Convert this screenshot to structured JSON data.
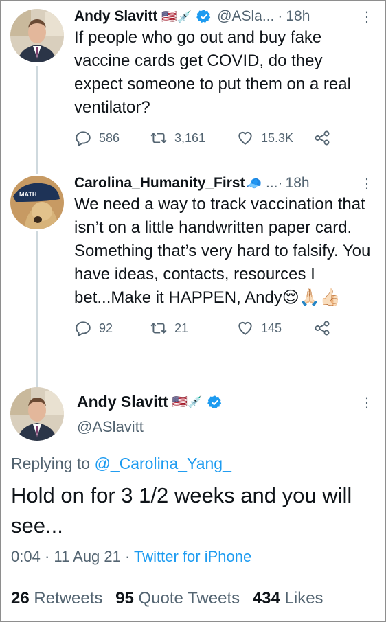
{
  "tweet1": {
    "name": "Andy Slavitt",
    "badges": "🇺🇸💉",
    "handle": "@ASla...",
    "dot": "·",
    "time": "18h",
    "more": "⋮",
    "text": "If people who go out and buy fake vaccine cards get COVID, do they expect someone to put them on a real ventilator?",
    "replies": "586",
    "retweets": "3,161",
    "likes": "15.3K"
  },
  "tweet2": {
    "name": "Carolina_Humanity_First",
    "badges": "🧢",
    "handle": "...",
    "dot": "·",
    "time": "18h",
    "more": "⋮",
    "text": "We need a way to track vaccination that isn’t on a little handwritten paper card. Something that’s very hard to falsify. You have ideas, contacts, resources I bet...Make it HAPPEN, Andy😌🙏🏻👍🏻",
    "replies": "92",
    "retweets": "21",
    "likes": "145",
    "avatar_cap_text": "MATH"
  },
  "focus": {
    "name": "Andy Slavitt",
    "badges": "🇺🇸💉",
    "handle": "@ASlavitt",
    "more": "⋮",
    "replying_prefix": "Replying to ",
    "replying_to": "@_Carolina_Yang_",
    "text": "Hold on for 3 1/2 weeks and you will see...",
    "time": "0:04",
    "dot": "·",
    "date": "11 Aug 21",
    "source": "Twitter for iPhone",
    "retweets_count": "26",
    "retweets_label": "Retweets",
    "quotes_count": "95",
    "quotes_label": "Quote Tweets",
    "likes_count": "434",
    "likes_label": "Likes"
  },
  "colors": {
    "accent": "#1d9bf0",
    "secondary_text": "#536471",
    "thread_line": "#cfd9de"
  }
}
